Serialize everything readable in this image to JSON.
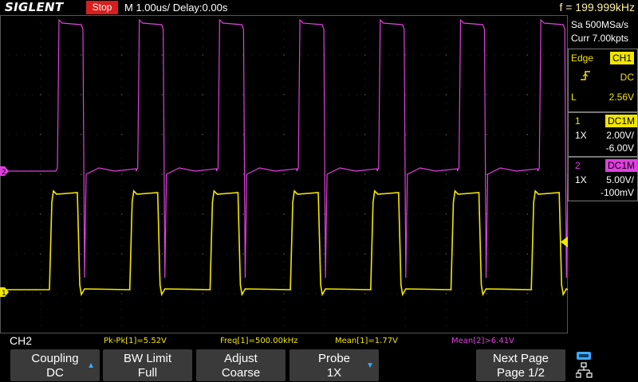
{
  "top_bar": {
    "brand": "SIGLENT",
    "run_state": "Stop",
    "timebase": "M 1.00us/  Delay:0.00s",
    "frequency": "f = 199.999kHz"
  },
  "sidebar": {
    "sample_rate": "Sa 500MSa/s",
    "memory_depth": "Curr 7.00kpts",
    "trigger": {
      "type_label": "Edge",
      "source": "CH1",
      "slope_icon": "rising-edge-icon",
      "coupling": "DC",
      "level_label": "L",
      "level": "2.56V"
    },
    "channel1": {
      "number": "1",
      "coupling": "DC1M",
      "probe": "1X",
      "scale": "2.00V/",
      "offset": "-6.00V"
    },
    "channel2": {
      "number": "2",
      "coupling": "DC1M",
      "probe": "1X",
      "scale": "5.00V/",
      "offset": "-100mV"
    }
  },
  "measurements": {
    "channel_label": "CH2",
    "pkpk": "Pk-Pk[1]=5.52V",
    "freq": "Freq[1]=500.00kHz",
    "mean1": "Mean[1]=1.77V",
    "mean2": "Mean[2]>6.41V"
  },
  "softkeys": [
    {
      "line1": "Coupling",
      "line2": "DC"
    },
    {
      "line1": "BW Limit",
      "line2": "Full"
    },
    {
      "line1": "Adjust",
      "line2": "Coarse"
    },
    {
      "line1": "Probe",
      "line2": "1X"
    },
    {
      "line1": "Next Page",
      "line2": "Page 1/2"
    }
  ],
  "markers": {
    "ch1_marker": "1",
    "ch2_marker": "2"
  },
  "colors": {
    "ch1": "#f2e600",
    "ch2": "#e040e0",
    "trigger_marker": "#29b6f6",
    "stop_red": "#d81e1e"
  }
}
